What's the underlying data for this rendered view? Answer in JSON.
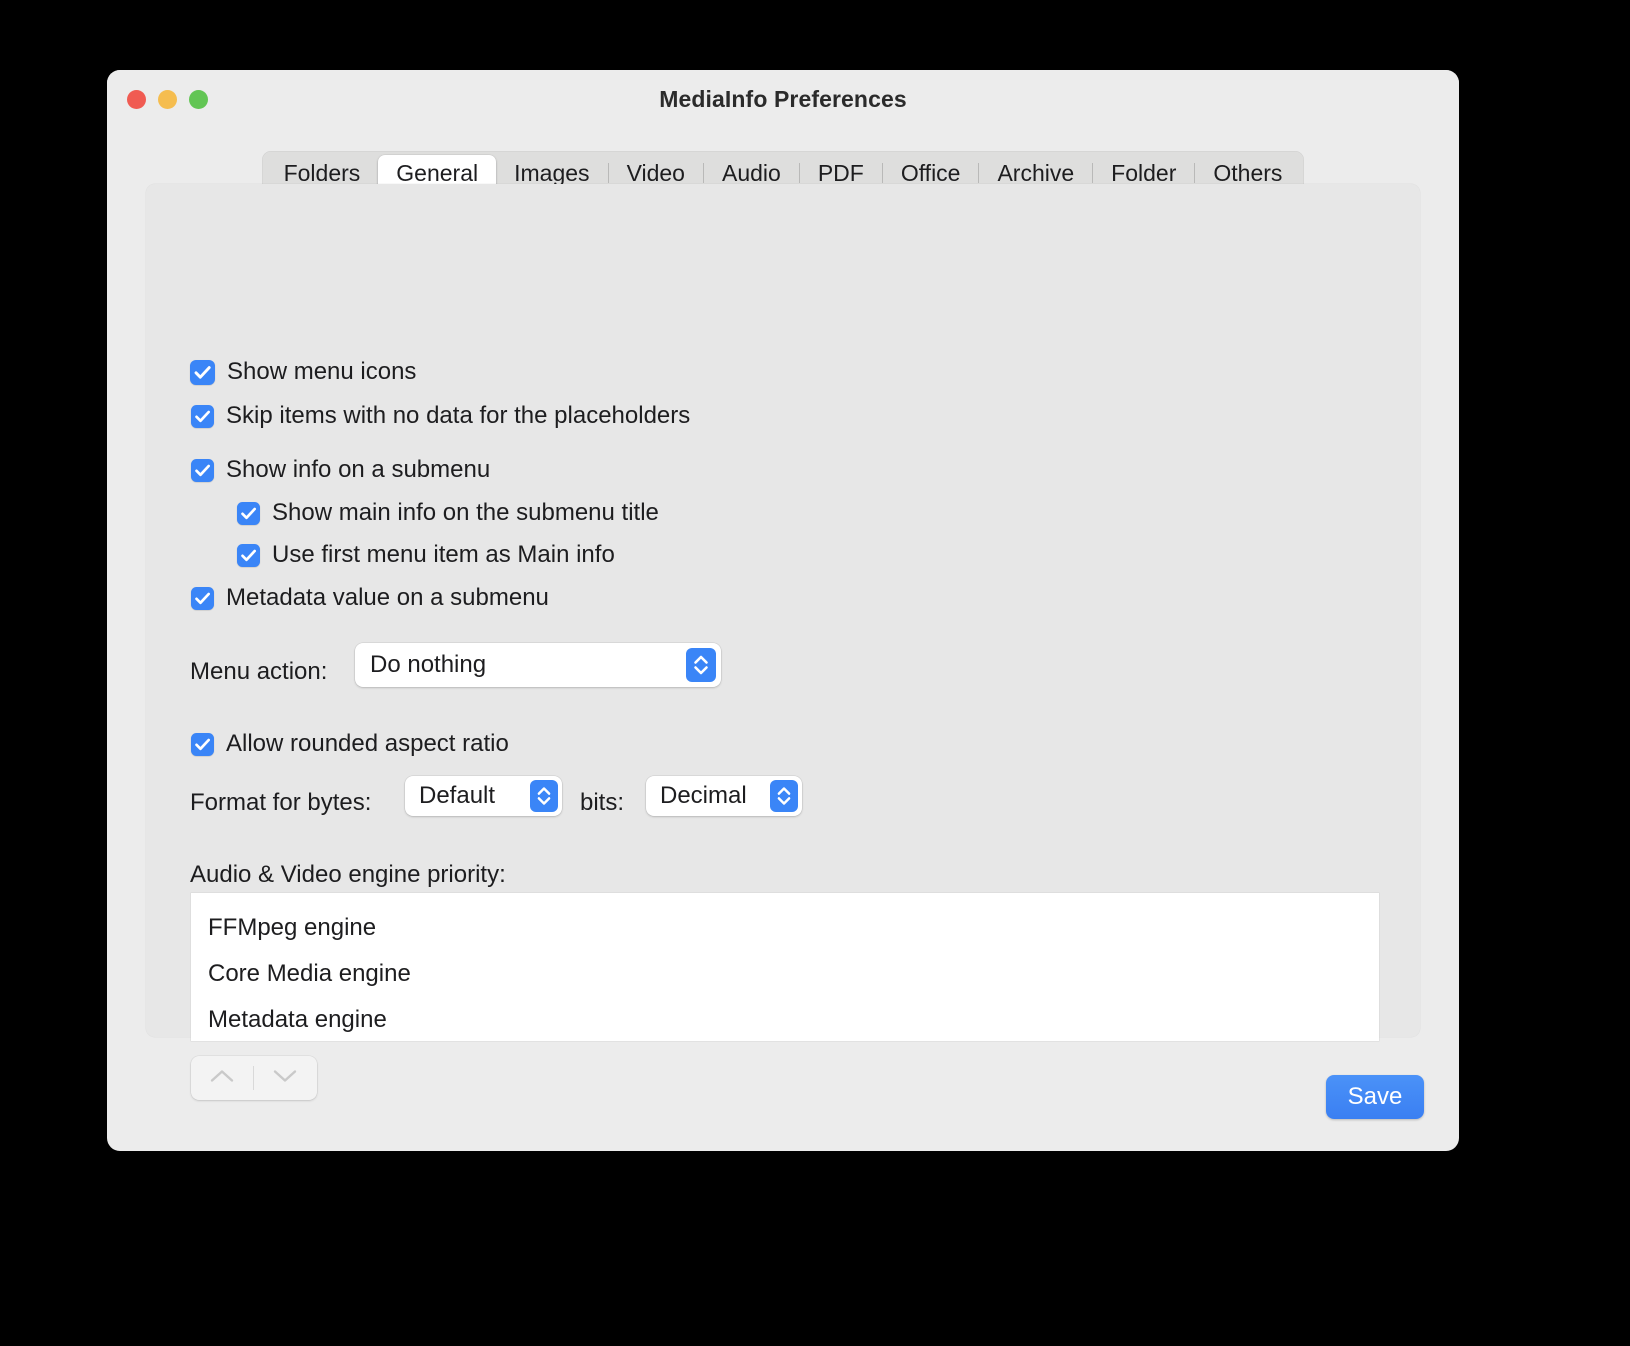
{
  "window": {
    "title": "MediaInfo Preferences",
    "traffic_lights": [
      "close",
      "minimize",
      "zoom"
    ]
  },
  "tabs": [
    {
      "label": "Folders",
      "selected": false
    },
    {
      "label": "General",
      "selected": true
    },
    {
      "label": "Images",
      "selected": false
    },
    {
      "label": "Video",
      "selected": false
    },
    {
      "label": "Audio",
      "selected": false
    },
    {
      "label": "PDF",
      "selected": false
    },
    {
      "label": "Office",
      "selected": false
    },
    {
      "label": "Archive",
      "selected": false
    },
    {
      "label": "Folder",
      "selected": false
    },
    {
      "label": "Others",
      "selected": false
    }
  ],
  "general": {
    "checkboxes": [
      {
        "label": "Show menu icons",
        "checked": true,
        "focused": true,
        "indent": 0
      },
      {
        "label": "Skip items with no data for the placeholders",
        "checked": true,
        "focused": false,
        "indent": 0
      },
      {
        "label": "Show info on a submenu",
        "checked": true,
        "focused": false,
        "indent": 0
      },
      {
        "label": "Show main info on the submenu title",
        "checked": true,
        "focused": false,
        "indent": 1
      },
      {
        "label": "Use first menu item as Main info",
        "checked": true,
        "focused": false,
        "indent": 1
      },
      {
        "label": "Metadata value on a submenu",
        "checked": true,
        "focused": false,
        "indent": 0
      },
      {
        "label": "Allow rounded aspect ratio",
        "checked": true,
        "focused": false,
        "indent": 0
      }
    ],
    "menu_action": {
      "label": "Menu action:",
      "value": "Do nothing"
    },
    "format": {
      "bytes_label": "Format for bytes:",
      "bytes_value": "Default",
      "bits_label": "bits:",
      "bits_value": "Decimal"
    },
    "engine_priority": {
      "label": "Audio & Video engine priority:",
      "items": [
        "FFMpeg engine",
        "Core Media engine",
        "Metadata engine"
      ],
      "move_up": "Move up",
      "move_down": "Move down"
    }
  },
  "footer": {
    "save_label": "Save"
  },
  "colors": {
    "accent": "#3a85f7",
    "window_bg": "#ececec",
    "content_bg": "#e7e7e7",
    "tabbar_bg": "#dededd",
    "text": "#1d1d1f",
    "traffic_red": "#f05b52",
    "traffic_yellow": "#f5bd4f",
    "traffic_green": "#62c554"
  }
}
